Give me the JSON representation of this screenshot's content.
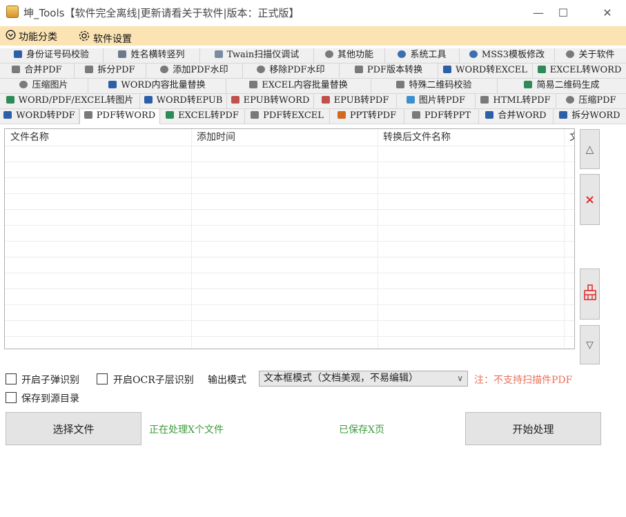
{
  "window": {
    "title": "坤_Tools【软件完全离线|更新请看关于软件|版本：正式版】",
    "minimize_glyph": "—",
    "maximize_glyph": "☐",
    "close_glyph": "✕"
  },
  "menu": [
    {
      "label": "功能分类",
      "icon": "category-icon"
    },
    {
      "label": "软件设置",
      "icon": "gear-icon"
    }
  ],
  "tab_rows": [
    [
      {
        "label": "身份证号码校验",
        "icon_color": "#2d5fa8"
      },
      {
        "label": "姓名横转竖列",
        "icon_color": "#6b7a8a"
      },
      {
        "label": "Twain扫描仪调试",
        "icon_color": "#7a8aa0"
      },
      {
        "label": "其他功能",
        "icon_color": "#7a7a7a"
      },
      {
        "label": "系统工具",
        "icon_color": "#3a6fb0"
      },
      {
        "label": "MSS3模板修改",
        "icon_color": "#3a6fb0"
      },
      {
        "label": "关于软件",
        "icon_color": "#7a7a7a"
      }
    ],
    [
      {
        "label": "合并PDF",
        "icon_color": "#7a7a7a"
      },
      {
        "label": "拆分PDF",
        "icon_color": "#7a7a7a"
      },
      {
        "label": "添加PDF水印",
        "icon_color": "#7a7a7a"
      },
      {
        "label": "移除PDF水印",
        "icon_color": "#7a7a7a"
      },
      {
        "label": "PDF版本转换",
        "icon_color": "#7a7a7a"
      },
      {
        "label": "WORD转EXCEL",
        "icon_color": "#2d5fa8"
      },
      {
        "label": "EXCEL转WORD",
        "icon_color": "#2e8b57"
      }
    ],
    [
      {
        "label": "压缩图片",
        "icon_color": "#7a7a7a"
      },
      {
        "label": "WORD内容批量替换",
        "icon_color": "#2d5fa8"
      },
      {
        "label": "EXCEL内容批量替换",
        "icon_color": "#7a7a7a"
      },
      {
        "label": "特殊二维码校验",
        "icon_color": "#7a7a7a"
      },
      {
        "label": "简易二维码生成",
        "icon_color": "#2e8b57"
      },
      {
        "label": "压缩PDF",
        "icon_color": "#7a7a7a"
      }
    ],
    [
      {
        "label": "WORD/PDF/EXCEL转图片",
        "icon_color": "#2e8b57"
      },
      {
        "label": "WORD转EPUB",
        "icon_color": "#2d5fa8"
      },
      {
        "label": "EPUB转WORD",
        "icon_color": "#c0504d"
      },
      {
        "label": "EPUB转PDF",
        "icon_color": "#c0504d"
      },
      {
        "label": "图片转PDF",
        "icon_color": "#3a8fd0"
      },
      {
        "label": "HTML转PDF",
        "icon_color": "#7a7a7a"
      },
      {
        "label": "压缩PDF",
        "icon_color": "#7a7a7a"
      }
    ],
    [
      {
        "label": "WORD转PDF",
        "icon_color": "#2d5fa8"
      },
      {
        "label": "PDF转WORD",
        "icon_color": "#7a7a7a"
      },
      {
        "label": "EXCEL转PDF",
        "icon_color": "#2e8b57"
      },
      {
        "label": "PDF转EXCEL",
        "icon_color": "#7a7a7a"
      },
      {
        "label": "PPT转PDF",
        "icon_color": "#d2691e"
      },
      {
        "label": "PDF转PPT",
        "icon_color": "#7a7a7a"
      },
      {
        "label": "合并WORD",
        "icon_color": "#2d5fa8"
      },
      {
        "label": "拆分WORD",
        "icon_color": "#2d5fa8"
      }
    ]
  ],
  "active_tab": "PDF转WORD",
  "file_list": {
    "columns": [
      "文件名称",
      "添加时间",
      "转换后文件名称",
      "文"
    ],
    "rows": []
  },
  "side_buttons": {
    "up_glyph": "△",
    "delete_glyph": "×",
    "down_glyph": "▽",
    "clear_icon": "broom-icon"
  },
  "options": {
    "sub_popup_label": "开启子弹识别",
    "ocr_layer_label": "开启OCR子层识别",
    "output_mode_label": "输出模式",
    "output_mode_value": "文本框模式（文档美观，不易编辑）",
    "save_to_source_label": "保存到源目录",
    "note": "注：不支持扫描件PDF"
  },
  "actions": {
    "select_files_label": "选择文件",
    "processing_status": "正在处理X个文件",
    "saved_status": "已保存X页",
    "start_label": "开始处理"
  },
  "colors": {
    "menubar_bg": "#fbe3b4",
    "status_green": "#3a9a3a",
    "note_red": "#e8705a",
    "delete_red": "#e03030",
    "clear_red": "#e03030"
  }
}
